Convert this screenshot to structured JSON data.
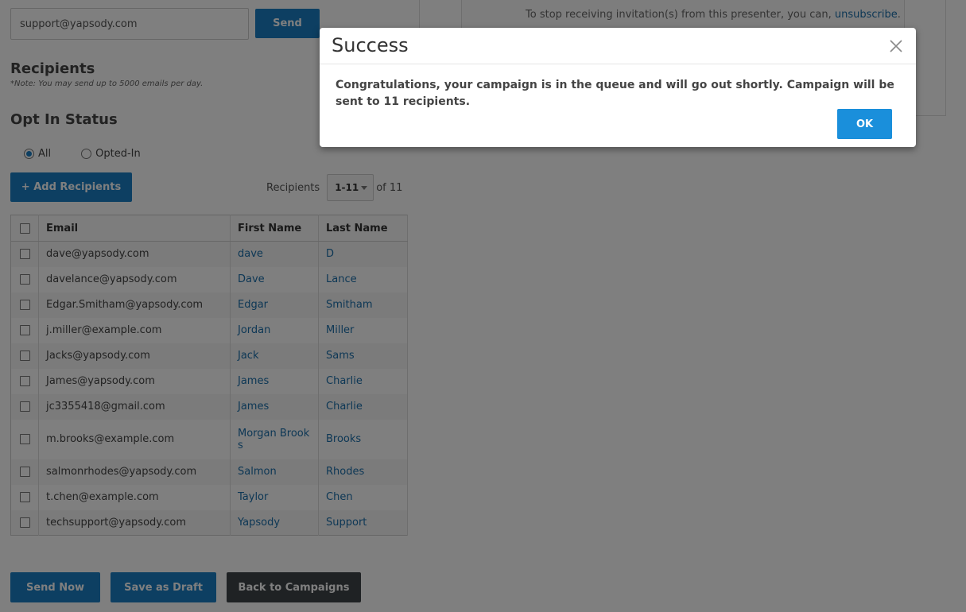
{
  "test_email": {
    "value": "support@yapsody.com",
    "send_label": "Send"
  },
  "recipients": {
    "title": "Recipients",
    "note": "*Note: You may send up to 5000 emails per day."
  },
  "opt_in": {
    "title": "Opt In Status",
    "options": [
      {
        "label": "All",
        "checked": true
      },
      {
        "label": "Opted-In",
        "checked": false
      }
    ]
  },
  "add_recipients_label": "+ Add Recipients",
  "pager": {
    "label": "Recipients",
    "range": "1-11",
    "of": "of 11"
  },
  "table": {
    "headers": {
      "email": "Email",
      "first": "First Name",
      "last": "Last Name"
    },
    "rows": [
      {
        "email": "dave@yapsody.com",
        "first": "dave",
        "last": "D"
      },
      {
        "email": "davelance@yapsody.com",
        "first": "Dave",
        "last": "Lance"
      },
      {
        "email": "Edgar.Smitham@yapsody.com",
        "first": "Edgar",
        "last": "Smitham"
      },
      {
        "email": "j.miller@example.com",
        "first": "Jordan",
        "last": "Miller"
      },
      {
        "email": "Jacks@yapsody.com",
        "first": "Jack",
        "last": "Sams"
      },
      {
        "email": "James@yapsody.com",
        "first": "James",
        "last": "Charlie"
      },
      {
        "email": "jc3355418@gmail.com",
        "first": "James",
        "last": "Charlie"
      },
      {
        "email": "m.brooks@example.com",
        "first": "Morgan Brook s",
        "last": "Brooks"
      },
      {
        "email": "salmonrhodes@yapsody.com",
        "first": "Salmon",
        "last": "Rhodes"
      },
      {
        "email": "t.chen@example.com",
        "first": "Taylor",
        "last": "Chen"
      },
      {
        "email": "techsupport@yapsody.com",
        "first": "Yapsody",
        "last": "Support"
      }
    ]
  },
  "actions": {
    "send_now": "Send Now",
    "save_draft": "Save as Draft",
    "back": "Back to Campaigns"
  },
  "preview": {
    "text": "To stop receiving invitation(s) from this presenter, you can,",
    "unsubscribe": "unsubscribe",
    "after": "."
  },
  "modal": {
    "title": "Success",
    "message": "Congratulations, your campaign is in the queue and will go out shortly. Campaign will be sent to 11 recipients.",
    "ok_label": "OK",
    "close_icon": "close-icon"
  },
  "colors": {
    "primary": "#1b7fc4",
    "dark": "#3f4449",
    "link": "#1b6fab",
    "ok": "#1a8fdb"
  }
}
